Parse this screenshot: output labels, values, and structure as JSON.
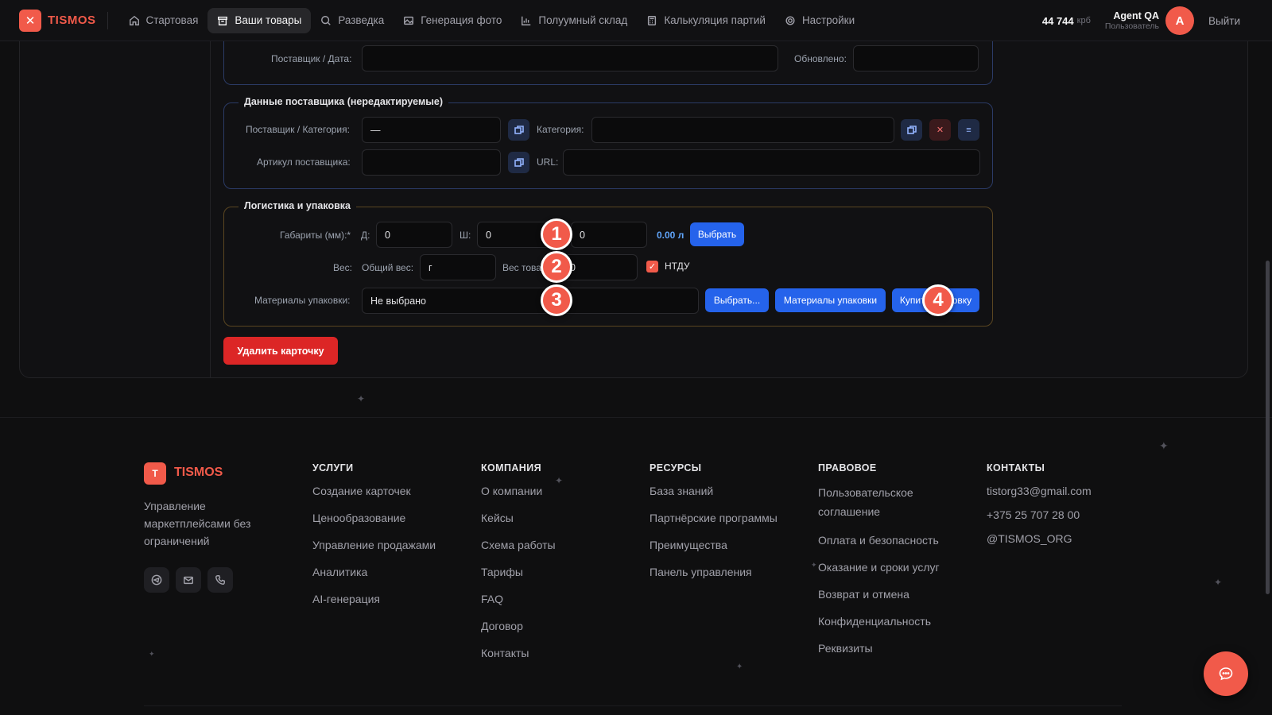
{
  "nav": {
    "logo_letter": "✕",
    "brand": "TISMOS",
    "items": [
      {
        "label": "Стартовая",
        "icon": "home-icon"
      },
      {
        "label": "Ваши товары",
        "icon": "box-icon"
      },
      {
        "label": "Разведка",
        "icon": "search-icon"
      },
      {
        "label": "Генерация фото",
        "icon": "image-icon"
      },
      {
        "label": "Полуумный склад",
        "icon": "chart-icon"
      },
      {
        "label": "Калькуляция партий",
        "icon": "calculator-icon"
      },
      {
        "label": "Настройки",
        "icon": "gear-icon"
      }
    ],
    "balance": "44 744",
    "balance_unit": "крб",
    "user_name": "Agent QA",
    "user_role": "Пользователь",
    "avatar_letter": "A",
    "logout": "Выйти"
  },
  "top_section": {
    "supplier_date_label": "Поставщик / Дата:",
    "supplier_date_value": "",
    "updated_label": "Обновлено:",
    "updated_value": ""
  },
  "supplier_section": {
    "legend": "Данные поставщика (нередактируемые)",
    "supplier_category_label": "Поставщик / Категория:",
    "supplier_category_value": "—",
    "category_label": "Категория:",
    "category_value": "",
    "article_label": "Артикул поставщика:",
    "article_value": "",
    "url_label": "URL:",
    "url_value": "",
    "clear_icon": "✕",
    "list_icon": "≡"
  },
  "logistics_section": {
    "legend": "Логистика и упаковка",
    "dims_label": "Габариты (мм):*",
    "length_label": "Д:",
    "length_value": "0",
    "width_label": "Ш:",
    "width_value": "0",
    "height_value": "0",
    "volume": "0.00 л",
    "choose_button": "Выбрать",
    "weight_label": "Вес:",
    "total_weight_label": "Общий вес:",
    "total_weight_value": "г",
    "item_weight_label": "Вес това",
    "item_weight_value": "0",
    "ntdu_label": "НТДУ",
    "ntdu_checked": true,
    "materials_label": "Материалы упаковки:",
    "materials_value": "Не выбрано",
    "materials_choose_button": "Выбрать...",
    "materials_button": "Материалы упаковки",
    "buy_packaging_button": "Купить упаковку"
  },
  "delete_button": "Удалить карточку",
  "markers": [
    "1",
    "2",
    "3",
    "4"
  ],
  "footer": {
    "logo_letter": "T",
    "brand": "TISMOS",
    "tagline": "Управление маркетплейсами без ограничений",
    "columns": [
      {
        "heading": "УСЛУГИ",
        "links": [
          "Создание карточек",
          "Ценообразование",
          "Управление продажами",
          "Аналитика",
          "AI-генерация"
        ]
      },
      {
        "heading": "КОМПАНИЯ",
        "links": [
          "О компании",
          "Кейсы",
          "Схема работы",
          "Тарифы",
          "FAQ",
          "Договор",
          "Контакты"
        ]
      },
      {
        "heading": "РЕСУРСЫ",
        "links": [
          "База знаний",
          "Партнёрские программы",
          "Преимущества",
          "Панель управления"
        ]
      },
      {
        "heading": "ПРАВОВОЕ",
        "links": [
          "Пользовательское соглашение",
          "Оплата и безопасность",
          "Оказание и сроки услуг",
          "Возврат и отмена",
          "Конфиденциальность",
          "Реквизиты"
        ]
      }
    ],
    "contacts_heading": "КОНТАКТЫ",
    "contacts": [
      "tistorg33@gmail.com",
      "+375 25 707 28 00",
      "@TISMOS_ORG"
    ]
  },
  "colors": {
    "accent": "#f15a4a",
    "primary_button": "#2563eb",
    "background": "#0f0f10",
    "delete_button": "#dc2626"
  }
}
